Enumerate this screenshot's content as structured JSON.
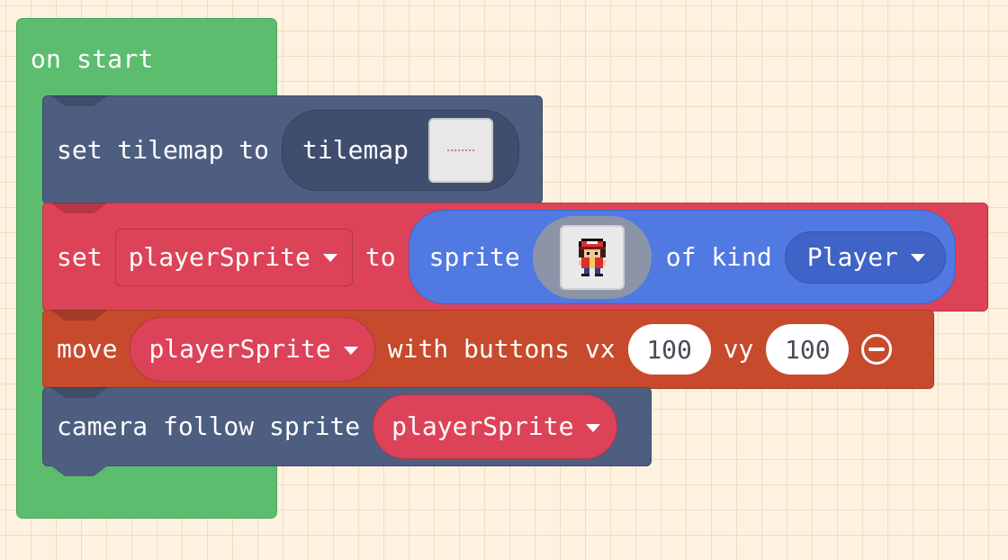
{
  "hat": {
    "label": "on start",
    "color": "#5cbd6f"
  },
  "blocks": {
    "set_tilemap": {
      "prefix": "set tilemap to",
      "reporter_label": "tilemap",
      "color": "#4d5e80"
    },
    "set_sprite": {
      "set_word": "set",
      "variable": "playerSprite",
      "to_word": "to",
      "sprite_word": "sprite",
      "of_kind_word": "of kind",
      "kind_value": "Player",
      "color": "#dd4358",
      "sprite_reporter_color": "#5079e2"
    },
    "move": {
      "move_word": "move",
      "variable": "playerSprite",
      "middle_text": "with buttons vx",
      "vx_value": "100",
      "vy_label": "vy",
      "vy_value": "100",
      "remove_icon": "minus-circle-icon",
      "color": "#c74a2c"
    },
    "camera": {
      "prefix": "camera follow sprite",
      "variable": "playerSprite",
      "color": "#4d5e80"
    }
  }
}
